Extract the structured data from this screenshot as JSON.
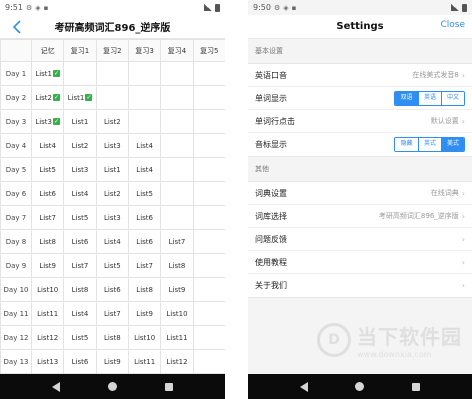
{
  "left": {
    "status": {
      "time": "9:51"
    },
    "title": "考研高频词汇896_逆序版",
    "table": {
      "headers": [
        "",
        "记忆",
        "复习1",
        "复习2",
        "复习3",
        "复习4",
        "复习5"
      ],
      "rows": [
        {
          "day": "Day 1",
          "cells": [
            "List1 ✓",
            "",
            "",
            "",
            "",
            ""
          ]
        },
        {
          "day": "Day 2",
          "cells": [
            "List2 ✓",
            "List1 ✓",
            "",
            "",
            "",
            ""
          ]
        },
        {
          "day": "Day 3",
          "cells": [
            "List3 ✓",
            "List1",
            "List2",
            "",
            "",
            ""
          ]
        },
        {
          "day": "Day 4",
          "cells": [
            "List4",
            "List2",
            "List3",
            "List4",
            "",
            ""
          ]
        },
        {
          "day": "Day 5",
          "cells": [
            "List5",
            "List3",
            "List1",
            "List4",
            "",
            ""
          ]
        },
        {
          "day": "Day 6",
          "cells": [
            "List6",
            "List4",
            "List2",
            "List5",
            "",
            ""
          ]
        },
        {
          "day": "Day 7",
          "cells": [
            "List7",
            "List5",
            "List3",
            "List6",
            "",
            ""
          ]
        },
        {
          "day": "Day 8",
          "cells": [
            "List8",
            "List6",
            "List4",
            "List6",
            "List7",
            ""
          ]
        },
        {
          "day": "Day 9",
          "cells": [
            "List9",
            "List7",
            "List5",
            "List7",
            "List8",
            ""
          ]
        },
        {
          "day": "Day 10",
          "cells": [
            "List10",
            "List8",
            "List6",
            "List8",
            "List9",
            ""
          ]
        },
        {
          "day": "Day 11",
          "cells": [
            "List11",
            "List4",
            "List7",
            "List9",
            "List10",
            ""
          ]
        },
        {
          "day": "Day 12",
          "cells": [
            "List12",
            "List5",
            "List8",
            "List10",
            "List11",
            ""
          ]
        },
        {
          "day": "Day 13",
          "cells": [
            "List13",
            "List6",
            "List9",
            "List11",
            "List12",
            ""
          ]
        }
      ]
    }
  },
  "right": {
    "status": {
      "time": "9:50"
    },
    "title": "Settings",
    "close_label": "Close",
    "section_basic": "基本设置",
    "rows_basic": [
      {
        "label": "英语口音",
        "value": "在线美式发音8"
      },
      {
        "label": "单词显示",
        "options": [
          "双语",
          "英语",
          "中文"
        ],
        "selected": 0
      },
      {
        "label": "单词行点击",
        "value": "默认设置"
      },
      {
        "label": "音标显示",
        "options": [
          "隐藏",
          "英式",
          "美式"
        ],
        "selected": 2
      }
    ],
    "section_other": "其他",
    "rows_other": [
      {
        "label": "词典设置",
        "value": "在线词典"
      },
      {
        "label": "词库选择",
        "value": "考研高频词汇896_逆序版"
      },
      {
        "label": "问题反馈",
        "value": ""
      },
      {
        "label": "使用教程",
        "value": ""
      },
      {
        "label": "关于我们",
        "value": ""
      }
    ],
    "watermark": {
      "logo": "D",
      "cn": "当下软件园",
      "url": "www.downxia.com"
    }
  }
}
